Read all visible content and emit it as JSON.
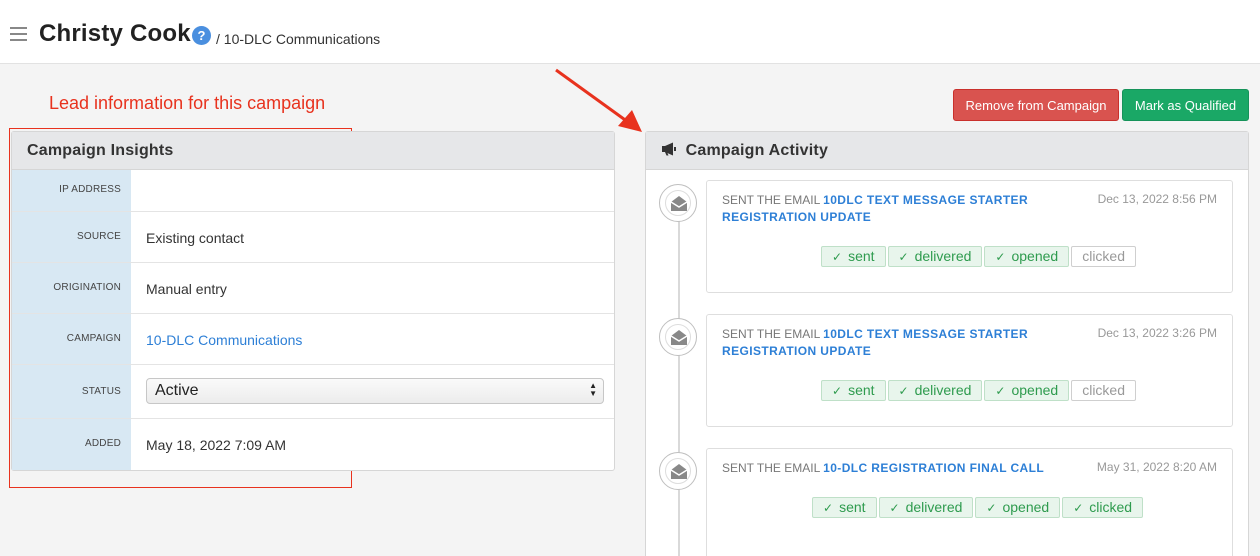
{
  "header": {
    "lead_name": "Christy Cook",
    "help_glyph": "?",
    "breadcrumb": "/ 10-DLC Communications"
  },
  "annotation": {
    "text": "Lead information for this campaign",
    "color": "#e8321e"
  },
  "actions": {
    "remove_label": "Remove from Campaign",
    "qualify_label": "Mark as Qualified"
  },
  "insights": {
    "title": "Campaign Insights",
    "rows": [
      {
        "label": "IP ADDRESS",
        "value": ""
      },
      {
        "label": "SOURCE",
        "value": "Existing contact"
      },
      {
        "label": "ORIGINATION",
        "value": "Manual entry"
      },
      {
        "label": "CAMPAIGN",
        "value": "10-DLC Communications"
      },
      {
        "label": "STATUS",
        "value": "Active"
      },
      {
        "label": "ADDED",
        "value": "May 18, 2022 7:09 AM"
      }
    ]
  },
  "activity": {
    "title": "Campaign Activity",
    "icon": "megaphone-icon",
    "items": [
      {
        "prefix": "SENT THE EMAIL",
        "email_name": "10DLC TEXT MESSAGE STARTER REGISTRATION UPDATE",
        "date": "Dec 13, 2022 8:56 PM",
        "statuses": [
          {
            "label": "sent",
            "active": true
          },
          {
            "label": "delivered",
            "active": true
          },
          {
            "label": "opened",
            "active": true
          },
          {
            "label": "clicked",
            "active": false
          }
        ]
      },
      {
        "prefix": "SENT THE EMAIL",
        "email_name": "10DLC TEXT MESSAGE STARTER REGISTRATION UPDATE",
        "date": "Dec 13, 2022 3:26 PM",
        "statuses": [
          {
            "label": "sent",
            "active": true
          },
          {
            "label": "delivered",
            "active": true
          },
          {
            "label": "opened",
            "active": true
          },
          {
            "label": "clicked",
            "active": false
          }
        ]
      },
      {
        "prefix": "SENT THE EMAIL",
        "email_name": "10-DLC REGISTRATION FINAL CALL",
        "date": "May 31, 2022 8:20 AM",
        "statuses": [
          {
            "label": "sent",
            "active": true
          },
          {
            "label": "delivered",
            "active": true
          },
          {
            "label": "opened",
            "active": true
          },
          {
            "label": "clicked",
            "active": true
          }
        ]
      }
    ]
  },
  "colors": {
    "danger": "#d9534f",
    "success": "#1aa866",
    "link": "#2d7fd6",
    "label_bg": "#d8e8f3"
  }
}
